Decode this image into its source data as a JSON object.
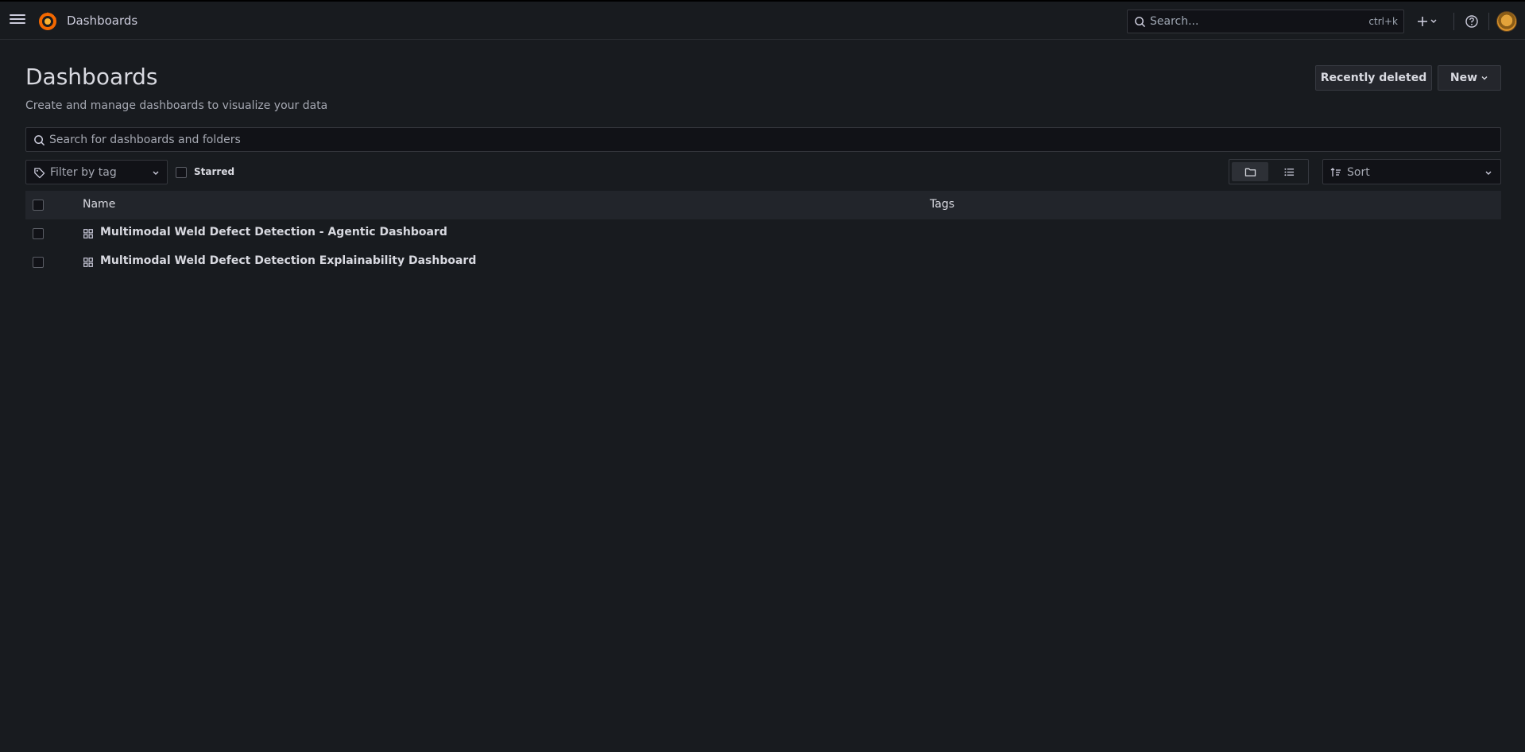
{
  "topbar": {
    "breadcrumb": "Dashboards",
    "search_placeholder": "Search...",
    "search_shortcut": "ctrl+k"
  },
  "page": {
    "title": "Dashboards",
    "subtitle": "Create and manage dashboards to visualize your data",
    "recently_deleted_label": "Recently deleted",
    "new_label": "New"
  },
  "search": {
    "placeholder": "Search for dashboards and folders"
  },
  "filters": {
    "tag_placeholder": "Filter by tag",
    "starred_label": "Starred",
    "sort_placeholder": "Sort"
  },
  "table": {
    "columns": [
      "Name",
      "Tags"
    ],
    "rows": [
      {
        "title": "Multimodal Weld Defect Detection - Agentic Dashboard"
      },
      {
        "title": "Multimodal Weld Defect Detection Explainability Dashboard"
      }
    ]
  },
  "colors": {
    "background": "#181b1f",
    "logo_orange": "#f46800",
    "text": "#d8d9e0"
  },
  "icons": [
    "menu-icon",
    "grafana-logo-icon",
    "search-icon",
    "plus-icon",
    "chevron-down-icon",
    "help-icon",
    "tag-icon",
    "folder-view-icon",
    "list-view-icon",
    "sort-icon",
    "dashboard-grid-icon"
  ]
}
